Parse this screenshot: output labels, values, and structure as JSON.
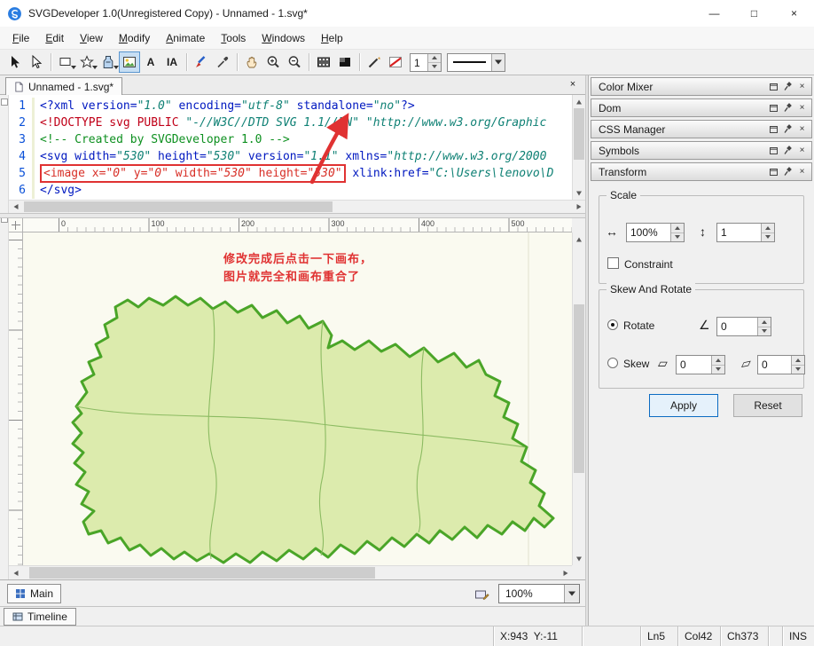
{
  "window": {
    "title": "SVGDeveloper 1.0(Unregistered Copy) - Unnamed - 1.svg*"
  },
  "titlebar_icons": {
    "minimize": "—",
    "maximize": "□",
    "close": "×"
  },
  "menu": {
    "items": [
      "File",
      "Edit",
      "View",
      "Modify",
      "Animate",
      "Tools",
      "Windows",
      "Help"
    ]
  },
  "toolbar": {
    "text_tool": "A",
    "italic_text_tool": "IA",
    "stroke_width": "1"
  },
  "doc_tab": {
    "label": "Unnamed - 1.svg*",
    "close": "×"
  },
  "code": {
    "lines": [
      {
        "num": "1",
        "segments": [
          [
            "tag",
            "<?xml version="
          ],
          [
            "str",
            "\"1.0\""
          ],
          [
            "tag",
            " encoding="
          ],
          [
            "str",
            "\"utf-8\""
          ],
          [
            "tag",
            " standalone="
          ],
          [
            "str",
            "\"no\""
          ],
          [
            "tag",
            "?>"
          ]
        ]
      },
      {
        "num": "2",
        "segments": [
          [
            "doc",
            "<!DOCTYPE svg PUBLIC "
          ],
          [
            "str",
            "\"-//W3C//DTD SVG 1.1//EN\""
          ],
          [
            "doc",
            " "
          ],
          [
            "str",
            "\"http://www.w3.org/Graphic"
          ]
        ]
      },
      {
        "num": "3",
        "segments": [
          [
            "com",
            "<!-- Created by SVGDeveloper 1.0 -->"
          ]
        ]
      },
      {
        "num": "4",
        "segments": [
          [
            "tag",
            "<svg width="
          ],
          [
            "str",
            "\"530\""
          ],
          [
            "tag",
            " height="
          ],
          [
            "str",
            "\"530\""
          ],
          [
            "tag",
            " version="
          ],
          [
            "str",
            "\"1.1\""
          ],
          [
            "tag",
            " xmlns="
          ],
          [
            "str",
            "\"http://www.w3.org/2000"
          ]
        ]
      },
      {
        "num": "5",
        "boxed": [
          [
            "red",
            "<image x="
          ],
          [
            "redstr",
            "\"0\""
          ],
          [
            "red",
            " y="
          ],
          [
            "redstr",
            "\"0\""
          ],
          [
            "red",
            " width="
          ],
          [
            "redstr",
            "\"530\""
          ],
          [
            "red",
            " height="
          ],
          [
            "redstr",
            "\"530\""
          ]
        ],
        "segments": [
          [
            "tag",
            " xlink:href="
          ],
          [
            "str",
            "\"C:\\Users\\lenovo\\D"
          ]
        ]
      },
      {
        "num": "6",
        "segments": [
          [
            "tag",
            "</svg>"
          ]
        ]
      }
    ]
  },
  "ruler": {
    "h_labels": [
      "0",
      "100",
      "200",
      "300",
      "400",
      "500"
    ]
  },
  "annotation": {
    "line1": "修改完成后点击一下画布，",
    "line2": "图片就完全和画布重合了"
  },
  "panels": {
    "headers": [
      "Color Mixer",
      "Dom",
      "CSS Manager",
      "Symbols",
      "Transform"
    ]
  },
  "transform": {
    "scale_group": "Scale",
    "scale_x": "100%",
    "scale_y": "1",
    "constraint_label": "Constraint",
    "skew_group": "Skew And Rotate",
    "rotate_label": "Rotate",
    "rotate_value": "0",
    "skew_label": "Skew",
    "skew_x": "0",
    "skew_y": "0",
    "apply_label": "Apply",
    "reset_label": "Reset"
  },
  "icons": {
    "h_arrows": "↔",
    "v_arrows": "↕",
    "angle": "∠",
    "skew_h": "▱",
    "skew_v": "▱"
  },
  "bottom_bar": {
    "main_tab": "Main",
    "zoom": "100%"
  },
  "timeline": {
    "tab": "Timeline"
  },
  "status": {
    "coords": "X:943  Y:-11",
    "line": "Ln5",
    "col": "Col42",
    "ch": "Ch373",
    "mode": "INS"
  }
}
